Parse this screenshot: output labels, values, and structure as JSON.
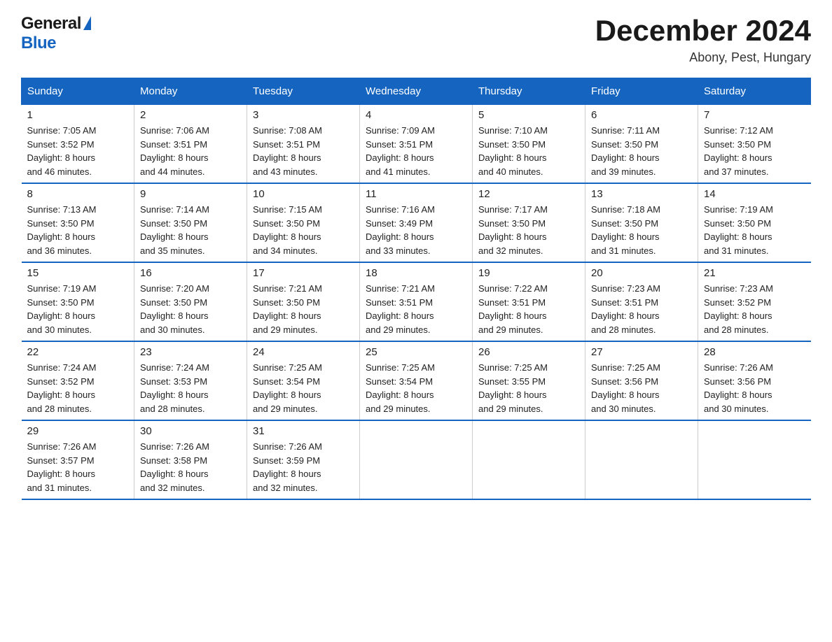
{
  "logo": {
    "general": "General",
    "blue": "Blue"
  },
  "header": {
    "month": "December 2024",
    "location": "Abony, Pest, Hungary"
  },
  "weekdays": [
    "Sunday",
    "Monday",
    "Tuesday",
    "Wednesday",
    "Thursday",
    "Friday",
    "Saturday"
  ],
  "weeks": [
    [
      {
        "day": "1",
        "sunrise": "Sunrise: 7:05 AM",
        "sunset": "Sunset: 3:52 PM",
        "daylight": "Daylight: 8 hours",
        "daylight2": "and 46 minutes."
      },
      {
        "day": "2",
        "sunrise": "Sunrise: 7:06 AM",
        "sunset": "Sunset: 3:51 PM",
        "daylight": "Daylight: 8 hours",
        "daylight2": "and 44 minutes."
      },
      {
        "day": "3",
        "sunrise": "Sunrise: 7:08 AM",
        "sunset": "Sunset: 3:51 PM",
        "daylight": "Daylight: 8 hours",
        "daylight2": "and 43 minutes."
      },
      {
        "day": "4",
        "sunrise": "Sunrise: 7:09 AM",
        "sunset": "Sunset: 3:51 PM",
        "daylight": "Daylight: 8 hours",
        "daylight2": "and 41 minutes."
      },
      {
        "day": "5",
        "sunrise": "Sunrise: 7:10 AM",
        "sunset": "Sunset: 3:50 PM",
        "daylight": "Daylight: 8 hours",
        "daylight2": "and 40 minutes."
      },
      {
        "day": "6",
        "sunrise": "Sunrise: 7:11 AM",
        "sunset": "Sunset: 3:50 PM",
        "daylight": "Daylight: 8 hours",
        "daylight2": "and 39 minutes."
      },
      {
        "day": "7",
        "sunrise": "Sunrise: 7:12 AM",
        "sunset": "Sunset: 3:50 PM",
        "daylight": "Daylight: 8 hours",
        "daylight2": "and 37 minutes."
      }
    ],
    [
      {
        "day": "8",
        "sunrise": "Sunrise: 7:13 AM",
        "sunset": "Sunset: 3:50 PM",
        "daylight": "Daylight: 8 hours",
        "daylight2": "and 36 minutes."
      },
      {
        "day": "9",
        "sunrise": "Sunrise: 7:14 AM",
        "sunset": "Sunset: 3:50 PM",
        "daylight": "Daylight: 8 hours",
        "daylight2": "and 35 minutes."
      },
      {
        "day": "10",
        "sunrise": "Sunrise: 7:15 AM",
        "sunset": "Sunset: 3:50 PM",
        "daylight": "Daylight: 8 hours",
        "daylight2": "and 34 minutes."
      },
      {
        "day": "11",
        "sunrise": "Sunrise: 7:16 AM",
        "sunset": "Sunset: 3:49 PM",
        "daylight": "Daylight: 8 hours",
        "daylight2": "and 33 minutes."
      },
      {
        "day": "12",
        "sunrise": "Sunrise: 7:17 AM",
        "sunset": "Sunset: 3:50 PM",
        "daylight": "Daylight: 8 hours",
        "daylight2": "and 32 minutes."
      },
      {
        "day": "13",
        "sunrise": "Sunrise: 7:18 AM",
        "sunset": "Sunset: 3:50 PM",
        "daylight": "Daylight: 8 hours",
        "daylight2": "and 31 minutes."
      },
      {
        "day": "14",
        "sunrise": "Sunrise: 7:19 AM",
        "sunset": "Sunset: 3:50 PM",
        "daylight": "Daylight: 8 hours",
        "daylight2": "and 31 minutes."
      }
    ],
    [
      {
        "day": "15",
        "sunrise": "Sunrise: 7:19 AM",
        "sunset": "Sunset: 3:50 PM",
        "daylight": "Daylight: 8 hours",
        "daylight2": "and 30 minutes."
      },
      {
        "day": "16",
        "sunrise": "Sunrise: 7:20 AM",
        "sunset": "Sunset: 3:50 PM",
        "daylight": "Daylight: 8 hours",
        "daylight2": "and 30 minutes."
      },
      {
        "day": "17",
        "sunrise": "Sunrise: 7:21 AM",
        "sunset": "Sunset: 3:50 PM",
        "daylight": "Daylight: 8 hours",
        "daylight2": "and 29 minutes."
      },
      {
        "day": "18",
        "sunrise": "Sunrise: 7:21 AM",
        "sunset": "Sunset: 3:51 PM",
        "daylight": "Daylight: 8 hours",
        "daylight2": "and 29 minutes."
      },
      {
        "day": "19",
        "sunrise": "Sunrise: 7:22 AM",
        "sunset": "Sunset: 3:51 PM",
        "daylight": "Daylight: 8 hours",
        "daylight2": "and 29 minutes."
      },
      {
        "day": "20",
        "sunrise": "Sunrise: 7:23 AM",
        "sunset": "Sunset: 3:51 PM",
        "daylight": "Daylight: 8 hours",
        "daylight2": "and 28 minutes."
      },
      {
        "day": "21",
        "sunrise": "Sunrise: 7:23 AM",
        "sunset": "Sunset: 3:52 PM",
        "daylight": "Daylight: 8 hours",
        "daylight2": "and 28 minutes."
      }
    ],
    [
      {
        "day": "22",
        "sunrise": "Sunrise: 7:24 AM",
        "sunset": "Sunset: 3:52 PM",
        "daylight": "Daylight: 8 hours",
        "daylight2": "and 28 minutes."
      },
      {
        "day": "23",
        "sunrise": "Sunrise: 7:24 AM",
        "sunset": "Sunset: 3:53 PM",
        "daylight": "Daylight: 8 hours",
        "daylight2": "and 28 minutes."
      },
      {
        "day": "24",
        "sunrise": "Sunrise: 7:25 AM",
        "sunset": "Sunset: 3:54 PM",
        "daylight": "Daylight: 8 hours",
        "daylight2": "and 29 minutes."
      },
      {
        "day": "25",
        "sunrise": "Sunrise: 7:25 AM",
        "sunset": "Sunset: 3:54 PM",
        "daylight": "Daylight: 8 hours",
        "daylight2": "and 29 minutes."
      },
      {
        "day": "26",
        "sunrise": "Sunrise: 7:25 AM",
        "sunset": "Sunset: 3:55 PM",
        "daylight": "Daylight: 8 hours",
        "daylight2": "and 29 minutes."
      },
      {
        "day": "27",
        "sunrise": "Sunrise: 7:25 AM",
        "sunset": "Sunset: 3:56 PM",
        "daylight": "Daylight: 8 hours",
        "daylight2": "and 30 minutes."
      },
      {
        "day": "28",
        "sunrise": "Sunrise: 7:26 AM",
        "sunset": "Sunset: 3:56 PM",
        "daylight": "Daylight: 8 hours",
        "daylight2": "and 30 minutes."
      }
    ],
    [
      {
        "day": "29",
        "sunrise": "Sunrise: 7:26 AM",
        "sunset": "Sunset: 3:57 PM",
        "daylight": "Daylight: 8 hours",
        "daylight2": "and 31 minutes."
      },
      {
        "day": "30",
        "sunrise": "Sunrise: 7:26 AM",
        "sunset": "Sunset: 3:58 PM",
        "daylight": "Daylight: 8 hours",
        "daylight2": "and 32 minutes."
      },
      {
        "day": "31",
        "sunrise": "Sunrise: 7:26 AM",
        "sunset": "Sunset: 3:59 PM",
        "daylight": "Daylight: 8 hours",
        "daylight2": "and 32 minutes."
      },
      null,
      null,
      null,
      null
    ]
  ]
}
